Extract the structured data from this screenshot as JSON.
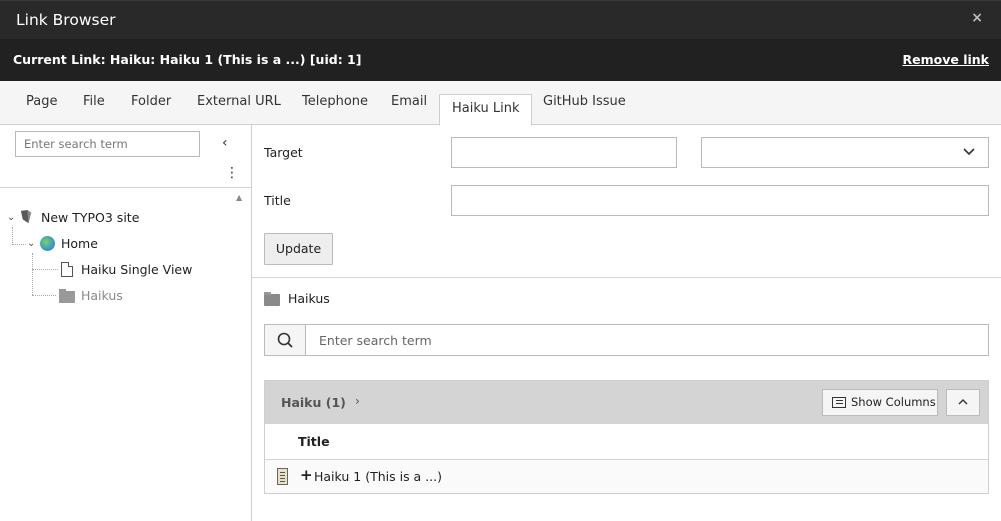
{
  "window": {
    "title": "Link Browser",
    "close_glyph": "×"
  },
  "link_bar": {
    "current_link": "Current Link: Haiku: Haiku 1 (This is a ...) [uid: 1]",
    "remove_link": "Remove link"
  },
  "tabs": [
    {
      "label": "Page"
    },
    {
      "label": "File"
    },
    {
      "label": "Folder"
    },
    {
      "label": "External URL"
    },
    {
      "label": "Telephone"
    },
    {
      "label": "Email"
    },
    {
      "label": "Haiku Link",
      "active": true
    },
    {
      "label": "GitHub Issue"
    }
  ],
  "sidebar": {
    "search_placeholder": "Enter search term",
    "collapse_glyph": "‹",
    "menu_glyph": "⋮",
    "tree": [
      {
        "label": "New TYPO3 site",
        "icon": "typo3-icon"
      },
      {
        "label": "Home",
        "icon": "globe-icon"
      },
      {
        "label": "Haiku Single View",
        "icon": "page-icon"
      },
      {
        "label": "Haikus",
        "icon": "folder-icon"
      }
    ]
  },
  "form": {
    "target_label": "Target",
    "title_label": "Title",
    "target_value": "",
    "target_select_value": "",
    "title_value": "",
    "update_label": "Update"
  },
  "records": {
    "folder_title": "Haikus",
    "search_placeholder": "Enter search term",
    "panel_title": "Haiku (1)",
    "show_columns_label": "Show Columns",
    "column_title": "Title",
    "rows": [
      {
        "title": "Haiku 1 (This is a ...)"
      }
    ]
  },
  "colors": {
    "titlebar": "#292929",
    "linkbar": "#212121",
    "panel_header": "#d4d4d4"
  }
}
